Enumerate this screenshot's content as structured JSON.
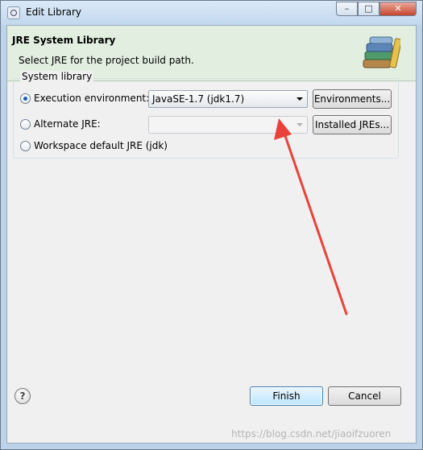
{
  "window": {
    "title": "Edit Library",
    "controls": {
      "minimize": "–",
      "maximize": "□",
      "close": "✕"
    }
  },
  "banner": {
    "title": "JRE System Library",
    "description": "Select JRE for the project build path.",
    "icon": "library-books-icon"
  },
  "group": {
    "label": "System library",
    "execution_env": {
      "label": "Execution environment:",
      "selected": true,
      "combo_value": "JavaSE-1.7 (jdk1.7)",
      "button": "Environments..."
    },
    "alternate_jre": {
      "label": "Alternate JRE:",
      "selected": false,
      "combo_value": "",
      "button": "Installed JREs..."
    },
    "workspace_default": {
      "label": "Workspace default JRE (jdk)",
      "selected": false
    }
  },
  "footer": {
    "help_glyph": "?",
    "finish": "Finish",
    "cancel": "Cancel"
  },
  "watermark": "https://blog.csdn.net/jiaoifzuoren",
  "colors": {
    "banner_bg": "#e2efe0",
    "annotation_arrow": "#e8423a",
    "default_button": "#bee6fd"
  }
}
